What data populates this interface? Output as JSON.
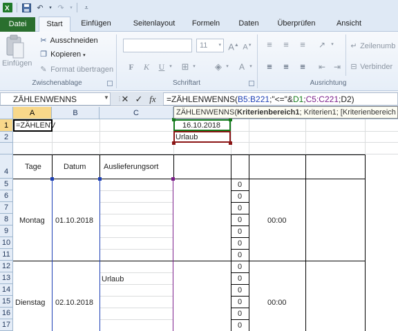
{
  "quick_access": {
    "excel_icon": "excel-logo",
    "save_icon": "save-icon",
    "undo_icon": "undo-icon",
    "redo_icon": "redo-icon"
  },
  "tabs": [
    {
      "label": "Datei"
    },
    {
      "label": "Start"
    },
    {
      "label": "Einfügen"
    },
    {
      "label": "Seitenlayout"
    },
    {
      "label": "Formeln"
    },
    {
      "label": "Daten"
    },
    {
      "label": "Überprüfen"
    },
    {
      "label": "Ansicht"
    }
  ],
  "ribbon": {
    "clipboard": {
      "paste_label": "Einfügen",
      "cut_label": "Ausschneiden",
      "copy_label": "Kopieren",
      "format_painter_label": "Format übertragen",
      "group_label": "Zwischenablage"
    },
    "font": {
      "font_size": "11",
      "bold": "F",
      "italic": "K",
      "underline": "U",
      "grow_font": "A",
      "shrink_font": "A",
      "group_label": "Schriftart"
    },
    "alignment": {
      "wrap_label": "Zeilenumb",
      "merge_label": "Verbinder",
      "group_label": "Ausrichtung"
    }
  },
  "formula_bar": {
    "name_box": "ZÄHLENWENNS",
    "cancel_icon": "✕",
    "enter_icon": "✓",
    "fx_icon": "fx",
    "formula_parts": {
      "p1": "=ZÄHLENWENNS(",
      "p2": "B5:B221",
      "p3": ";\"<=\"&",
      "p4": "D1",
      "p5": ";",
      "p6": "C5:C221",
      "p7": ";D2)"
    }
  },
  "tooltip": {
    "fn": "ZÄHLENWENNS(",
    "arg_bold": "Kriterienbereich1",
    "rest": "; Kriterien1; [Kriterienbereich"
  },
  "sheet": {
    "columns": [
      "A",
      "B",
      "C"
    ],
    "rows": [
      "1",
      "2",
      "",
      "4",
      "5",
      "6",
      "7",
      "8",
      "9",
      "10",
      "11",
      "12",
      "13",
      "14",
      "15",
      "16",
      "17"
    ],
    "cells": {
      "A1": "=ZÄHLENV",
      "D1": "16.10.2018",
      "D2": "Urlaub",
      "A4": "Tage",
      "B4": "Datum",
      "C4": "Auslieferungsort",
      "A8": "Montag",
      "B8": "01.10.2018",
      "A15": "Dienstag",
      "B15": "02.10.2018",
      "C13": "Urlaub",
      "E8": "00:00",
      "E15": "00:00"
    },
    "zeros": [
      "0",
      "0",
      "0",
      "0",
      "0",
      "0",
      "0",
      "0",
      "0",
      "0",
      "0",
      "0",
      "0"
    ]
  }
}
